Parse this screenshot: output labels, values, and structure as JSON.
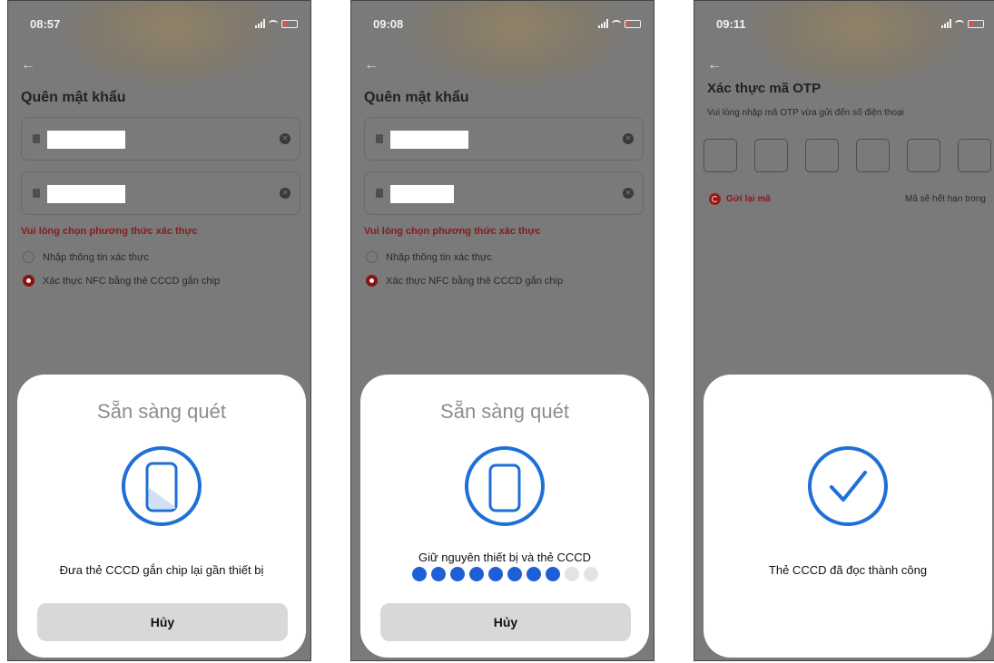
{
  "colors": {
    "accent_blue": "#1f5fd6",
    "brand_red": "#8b1212",
    "sheet_bg": "#ffffff",
    "dim_overlay": "#767676",
    "cancel_bg": "#d8d8da"
  },
  "screen1": {
    "status_time": "08:57",
    "back_icon": "back-arrow-icon",
    "page_title": "Quên mật khẩu",
    "prompt": "Vui lòng chọn phương thức xác thực",
    "option_info": "Nhập thông tin xác thực",
    "option_nfc": "Xác thực NFC bằng thẻ CCCD gắn chip",
    "sheet": {
      "title": "Sẵn sàng quét",
      "message": "Đưa thẻ CCCD gắn chip lại gần thiết bị",
      "cancel": "Hủy"
    }
  },
  "screen2": {
    "status_time": "09:08",
    "back_icon": "back-arrow-icon",
    "page_title": "Quên mật khẩu",
    "prompt": "Vui lòng chọn phương thức xác thực",
    "option_info": "Nhập thông tin xác thực",
    "option_nfc": "Xác thực NFC bằng thẻ CCCD gắn chip",
    "sheet": {
      "title": "Sẵn sàng quét",
      "message": "Giữ nguyên thiết bị và thẻ CCCD",
      "progress_done": 8,
      "progress_total": 10,
      "cancel": "Hủy"
    }
  },
  "screen3": {
    "status_time": "09:11",
    "back_icon": "back-arrow-icon",
    "page_title": "Xác thực mã OTP",
    "subtitle": "Vui lòng nhập mã OTP vừa gửi đến số điện thoại",
    "otp_boxes": 6,
    "resend": "Gửi lại mã",
    "expire": "Mã sẽ hết hạn trong",
    "sheet": {
      "message": "Thẻ CCCD đã đọc thành công"
    }
  }
}
